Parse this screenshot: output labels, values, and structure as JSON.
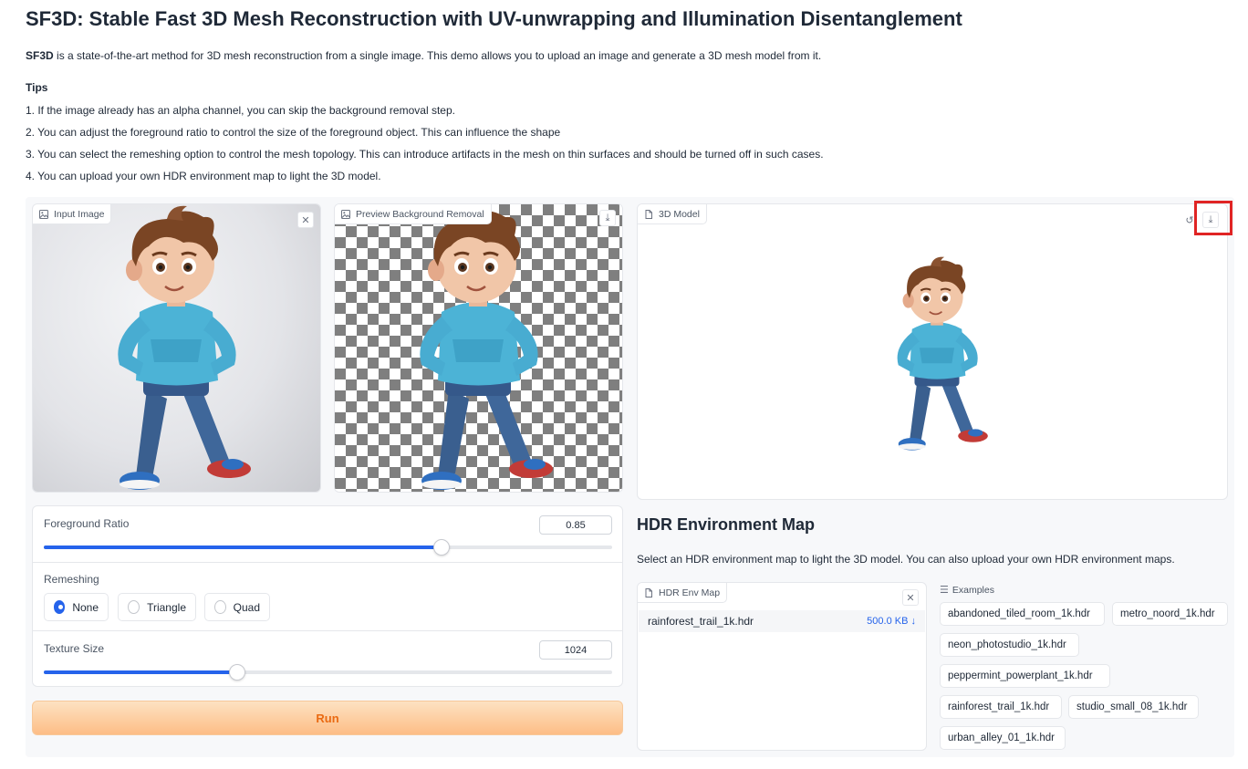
{
  "page": {
    "title": "SF3D: Stable Fast 3D Mesh Reconstruction with UV-unwrapping and Illumination Disentanglement",
    "intro_bold": "SF3D",
    "intro_rest": " is a state-of-the-art method for 3D mesh reconstruction from a single image. This demo allows you to upload an image and generate a 3D mesh model from it.",
    "tips_heading": "Tips",
    "tips": [
      "1. If the image already has an alpha channel, you can skip the background removal step.",
      "2. You can adjust the foreground ratio to control the size of the foreground object. This can influence the shape",
      "3. You can select the remeshing option to control the mesh topology. This can introduce artifacts in the mesh on thin surfaces and should be turned off in such cases.",
      "4. You can upload your own HDR environment map to light the 3D model."
    ]
  },
  "input_image": {
    "label": "Input Image",
    "icon": "image-icon"
  },
  "preview": {
    "label": "Preview Background Removal",
    "icon": "image-icon"
  },
  "model": {
    "label": "3D Model",
    "icon": "file-icon"
  },
  "foreground_ratio": {
    "label": "Foreground Ratio",
    "value": "0.85",
    "min": 0.5,
    "max": 1.0,
    "fraction": 0.7
  },
  "remeshing": {
    "label": "Remeshing",
    "options": [
      "None",
      "Triangle",
      "Quad"
    ],
    "selected": "None"
  },
  "texture_size": {
    "label": "Texture Size",
    "value": "1024",
    "fraction": 0.34
  },
  "run_button": {
    "label": "Run"
  },
  "hdr": {
    "title": "HDR Environment Map",
    "description": "Select an HDR environment map to light the 3D model. You can also upload your own HDR environment maps.",
    "file_label": "HDR Env Map",
    "file_name": "rainforest_trail_1k.hdr",
    "file_size": "500.0 KB ↓"
  },
  "examples": {
    "label": "Examples",
    "items": [
      "abandoned_tiled_room_1k.hdr",
      "metro_noord_1k.hdr",
      "neon_photostudio_1k.hdr",
      "peppermint_powerplant_1k.hdr",
      "rainforest_trail_1k.hdr",
      "studio_small_08_1k.hdr",
      "urban_alley_01_1k.hdr"
    ]
  },
  "colors": {
    "accent": "#2563eb",
    "run_text": "#ea6a12",
    "highlight": "#e02424"
  }
}
